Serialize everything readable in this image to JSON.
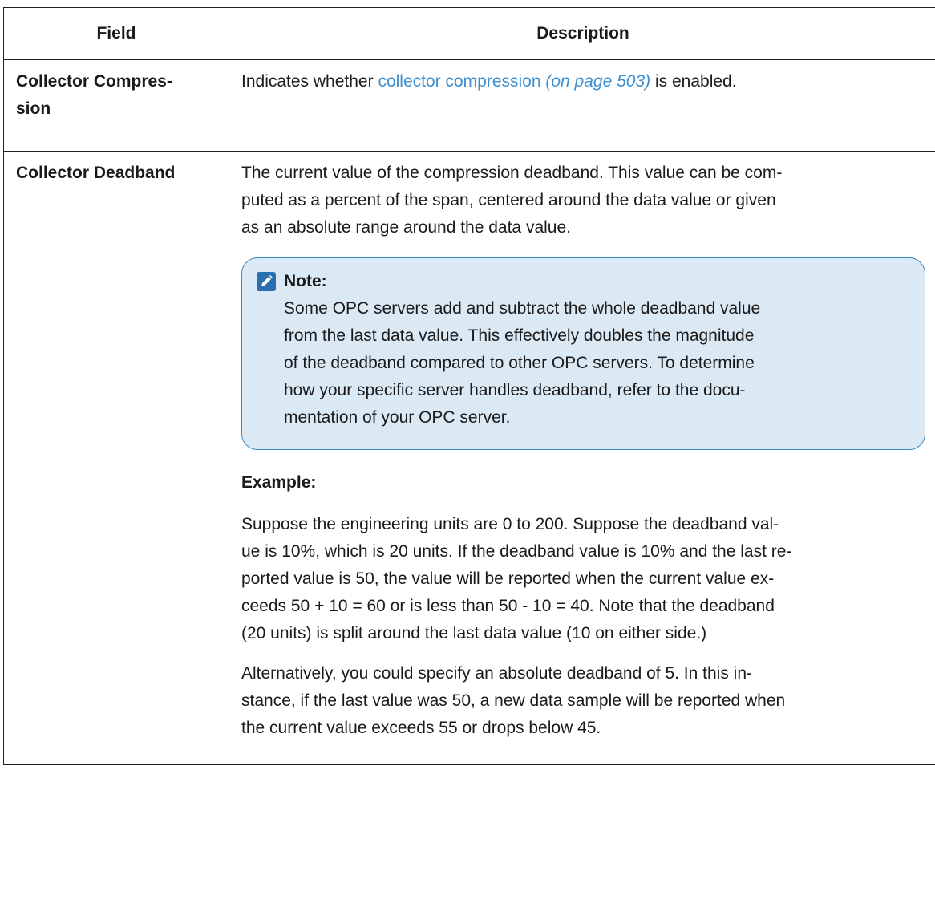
{
  "table": {
    "headers": [
      "Field",
      "Description"
    ],
    "rows": [
      {
        "field": "Collector Compres-\nsion",
        "desc_prefix": "Indicates whether ",
        "link_text": "collector compression",
        "page_ref": "(on page 503)",
        "desc_suffix": " is enabled."
      },
      {
        "field": "Collector Deadband",
        "desc": "The current value of the compression deadband. This value can be com-\nputed as a percent of the span, centered around the data value or given\nas an absolute range around the data value.",
        "note": {
          "icon": "pencil-icon",
          "title": "Note:",
          "body": "Some OPC servers add and subtract the whole deadband value\nfrom the last data value. This effectively doubles the magnitude\nof the deadband compared to other OPC servers. To determine\nhow your specific server handles deadband, refer to the docu-\nmentation of your OPC server."
        },
        "example_label": "Example:",
        "example_p1": "Suppose the engineering units are 0 to 200. Suppose the deadband val-\nue is 10%, which is 20 units. If the deadband value is 10% and the last re-\nported value is 50, the value will be reported when the current value ex-\nceeds 50 + 10 = 60 or is less than 50 - 10 = 40. Note that the deadband\n(20 units) is split around the last data value (10 on either side.)",
        "example_p2": "Alternatively, you could specify an absolute deadband of 5. In this in-\nstance, if the last value was 50, a new data sample will be reported when\nthe current value exceeds 55 or drops below 45."
      }
    ]
  },
  "colors": {
    "link": "#3f8fd0",
    "note_bg": "#dbe9f5",
    "note_border": "#3a8ac4"
  }
}
